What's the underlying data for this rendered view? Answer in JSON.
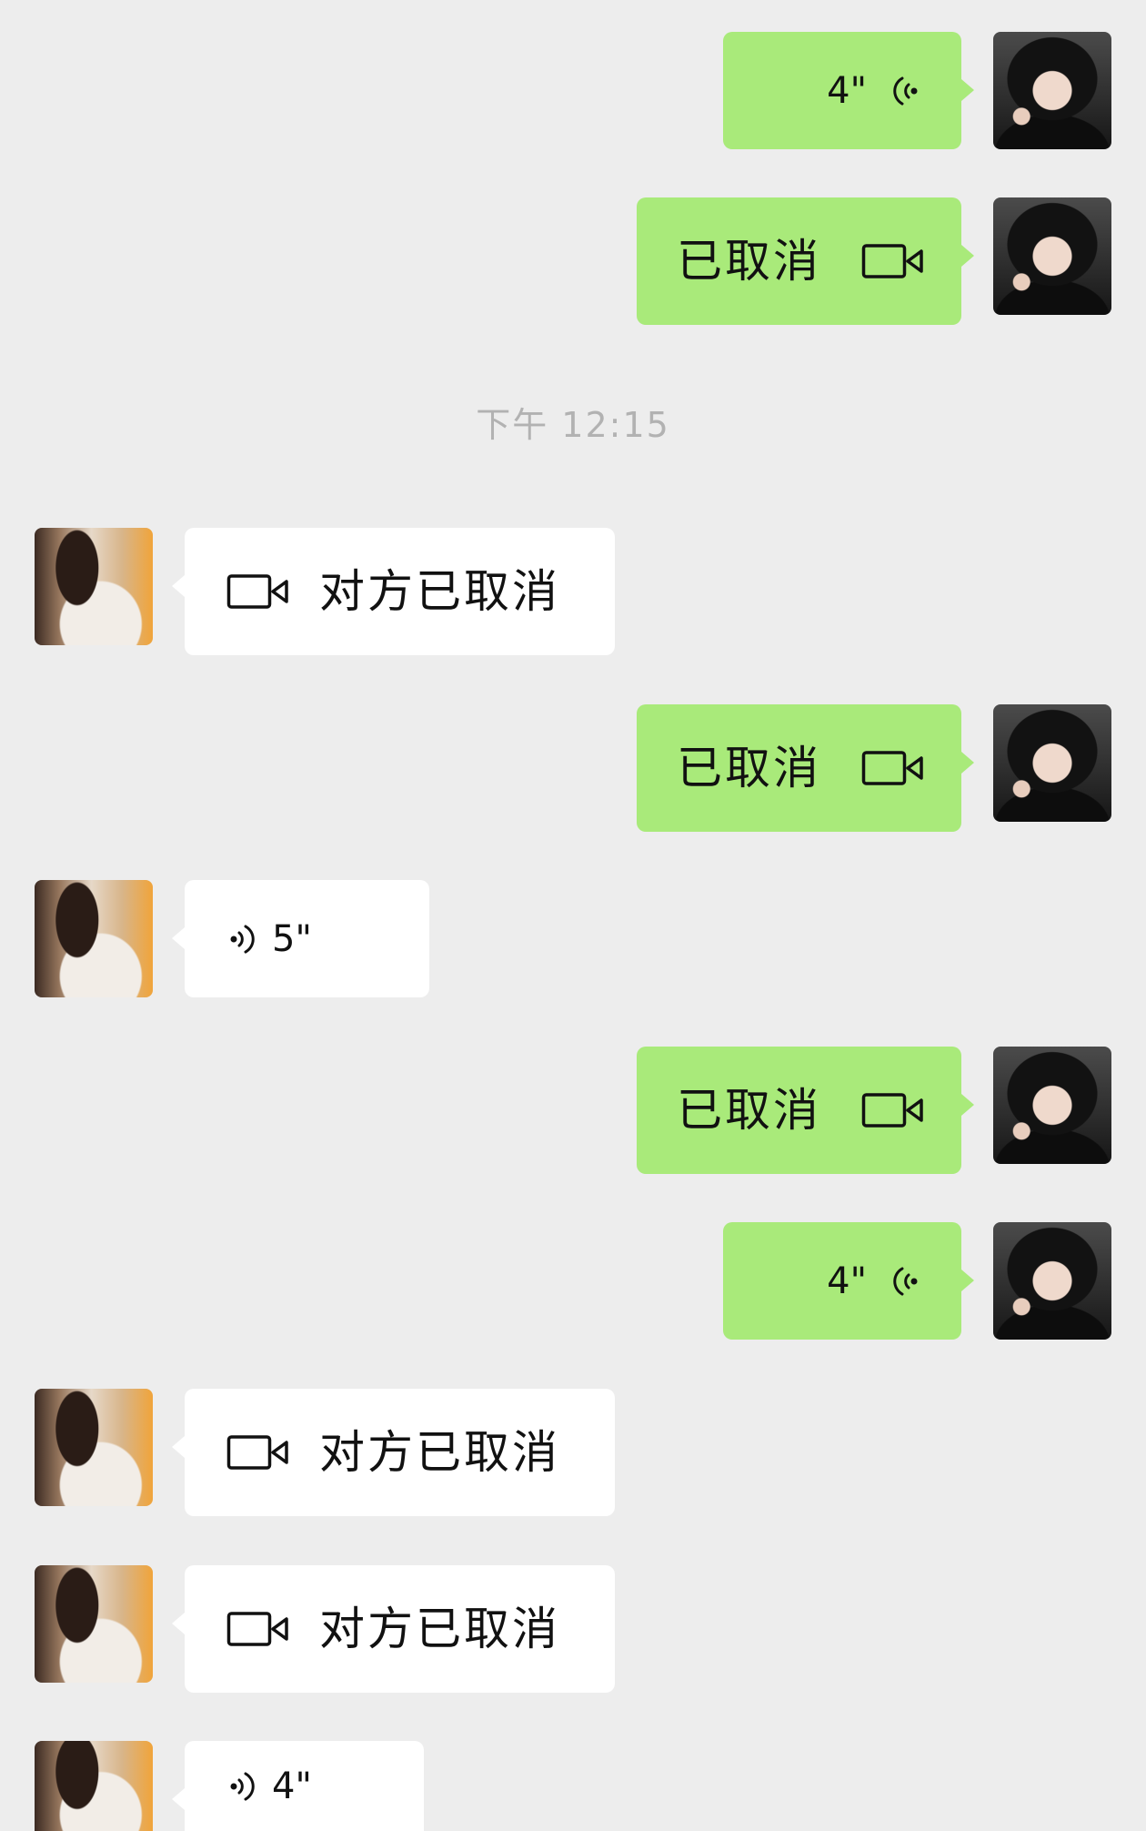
{
  "timestamp": "下午 12:15",
  "messages": [
    {
      "outgoing": true,
      "icon": "voice-icon",
      "text": "4\""
    },
    {
      "outgoing": true,
      "icon": "video-camera-icon",
      "text": "已取消"
    },
    {
      "outgoing": false,
      "icon": "video-camera-icon",
      "text": "对方已取消"
    },
    {
      "outgoing": true,
      "icon": "video-camera-icon",
      "text": "已取消"
    },
    {
      "outgoing": false,
      "icon": "voice-icon",
      "text": "5\""
    },
    {
      "outgoing": true,
      "icon": "video-camera-icon",
      "text": "已取消"
    },
    {
      "outgoing": true,
      "icon": "voice-icon",
      "text": "4\""
    },
    {
      "outgoing": false,
      "icon": "video-camera-icon",
      "text": "对方已取消"
    },
    {
      "outgoing": false,
      "icon": "video-camera-icon",
      "text": "对方已取消"
    },
    {
      "outgoing": false,
      "icon": "voice-icon",
      "text": "4\""
    }
  ],
  "colors": {
    "background": "#ededed",
    "sent_bubble": "#a9ea7a",
    "received_bubble": "#ffffff",
    "timestamp": "#b2b2b2"
  }
}
